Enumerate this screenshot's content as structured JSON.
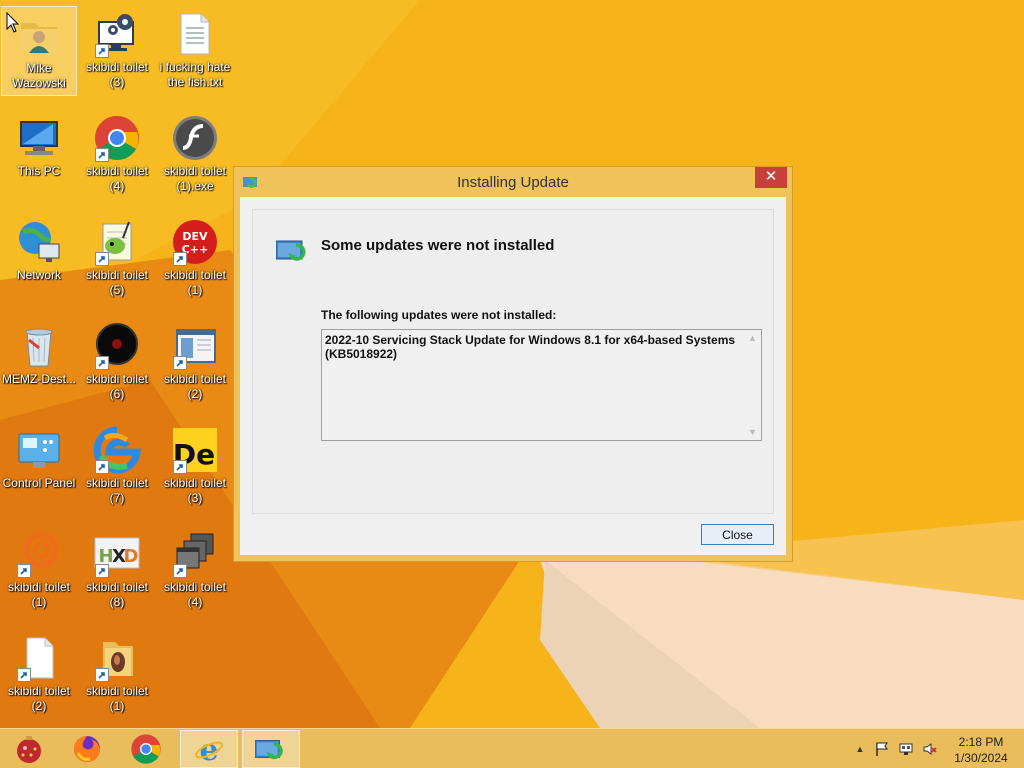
{
  "desktop": {
    "icons": [
      {
        "label": "Mike Wazowski",
        "icon": "user-folder-icon",
        "shortcut": false,
        "selected": true
      },
      {
        "label": "skibidi toilet (3)",
        "icon": "gear-monitor-icon",
        "shortcut": true
      },
      {
        "label": "i fucking hate the fish.txt",
        "icon": "text-file-icon",
        "shortcut": false
      },
      {
        "label": "This PC",
        "icon": "computer-icon",
        "shortcut": false
      },
      {
        "label": "skibidi toilet (4)",
        "icon": "chrome-icon",
        "shortcut": true
      },
      {
        "label": "skibidi toilet (1).exe",
        "icon": "flash-icon",
        "shortcut": false
      },
      {
        "label": "Network",
        "icon": "network-icon",
        "shortcut": false
      },
      {
        "label": "skibidi toilet (5)",
        "icon": "notepad-plus-icon",
        "shortcut": true
      },
      {
        "label": "skibidi toilet (1)",
        "icon": "dev-cpp-icon",
        "shortcut": true
      },
      {
        "label": "MEMZ-Dest...",
        "icon": "recycle-bin-icon",
        "shortcut": false
      },
      {
        "label": "skibidi toilet (6)",
        "icon": "black-circle-app-icon",
        "shortcut": true
      },
      {
        "label": "skibidi toilet (2)",
        "icon": "window-app-icon",
        "shortcut": true
      },
      {
        "label": "Control Panel",
        "icon": "control-panel-icon",
        "shortcut": false
      },
      {
        "label": "skibidi toilet (7)",
        "icon": "edge-icon",
        "shortcut": true
      },
      {
        "label": "skibidi toilet (3)",
        "icon": "de-app-icon",
        "shortcut": true
      },
      {
        "label": "skibidi toilet (1)",
        "icon": "orange-ring-icon",
        "shortcut": true
      },
      {
        "label": "skibidi toilet (8)",
        "icon": "hxd-icon",
        "shortcut": true
      },
      {
        "label": "skibidi toilet (4)",
        "icon": "stacked-windows-icon",
        "shortcut": true
      },
      {
        "label": "skibidi toilet (2)",
        "icon": "blank-file-icon",
        "shortcut": true
      },
      {
        "label": "skibidi toilet (1)",
        "icon": "media-folder-icon",
        "shortcut": true
      }
    ]
  },
  "dialog": {
    "title": "Installing Update",
    "close_glyph": "✕",
    "header": "Some updates were not installed",
    "list_label": "The following updates were not installed:",
    "updates_text": "2022-10 Servicing Stack Update for Windows 8.1 for x64-based Systems (KB5018922)",
    "close_button": "Close"
  },
  "taskbar": {
    "pinned": [
      {
        "icon": "ornament-app-icon",
        "active": false
      },
      {
        "icon": "firefox-icon",
        "active": false
      },
      {
        "icon": "chrome-icon",
        "active": false
      },
      {
        "icon": "internet-explorer-icon",
        "active": true
      },
      {
        "icon": "windows-update-icon",
        "active": true
      }
    ],
    "tray": {
      "show_hidden_glyph": "▲",
      "icons": [
        "flag-icon",
        "network-status-icon",
        "volume-muted-icon"
      ],
      "time": "2:18 PM",
      "date": "1/30/2024"
    }
  },
  "colors": {
    "wallpaper_orange": "#f6b41a",
    "accent_close": "#c7413a",
    "button_border": "#3c7fb1"
  }
}
